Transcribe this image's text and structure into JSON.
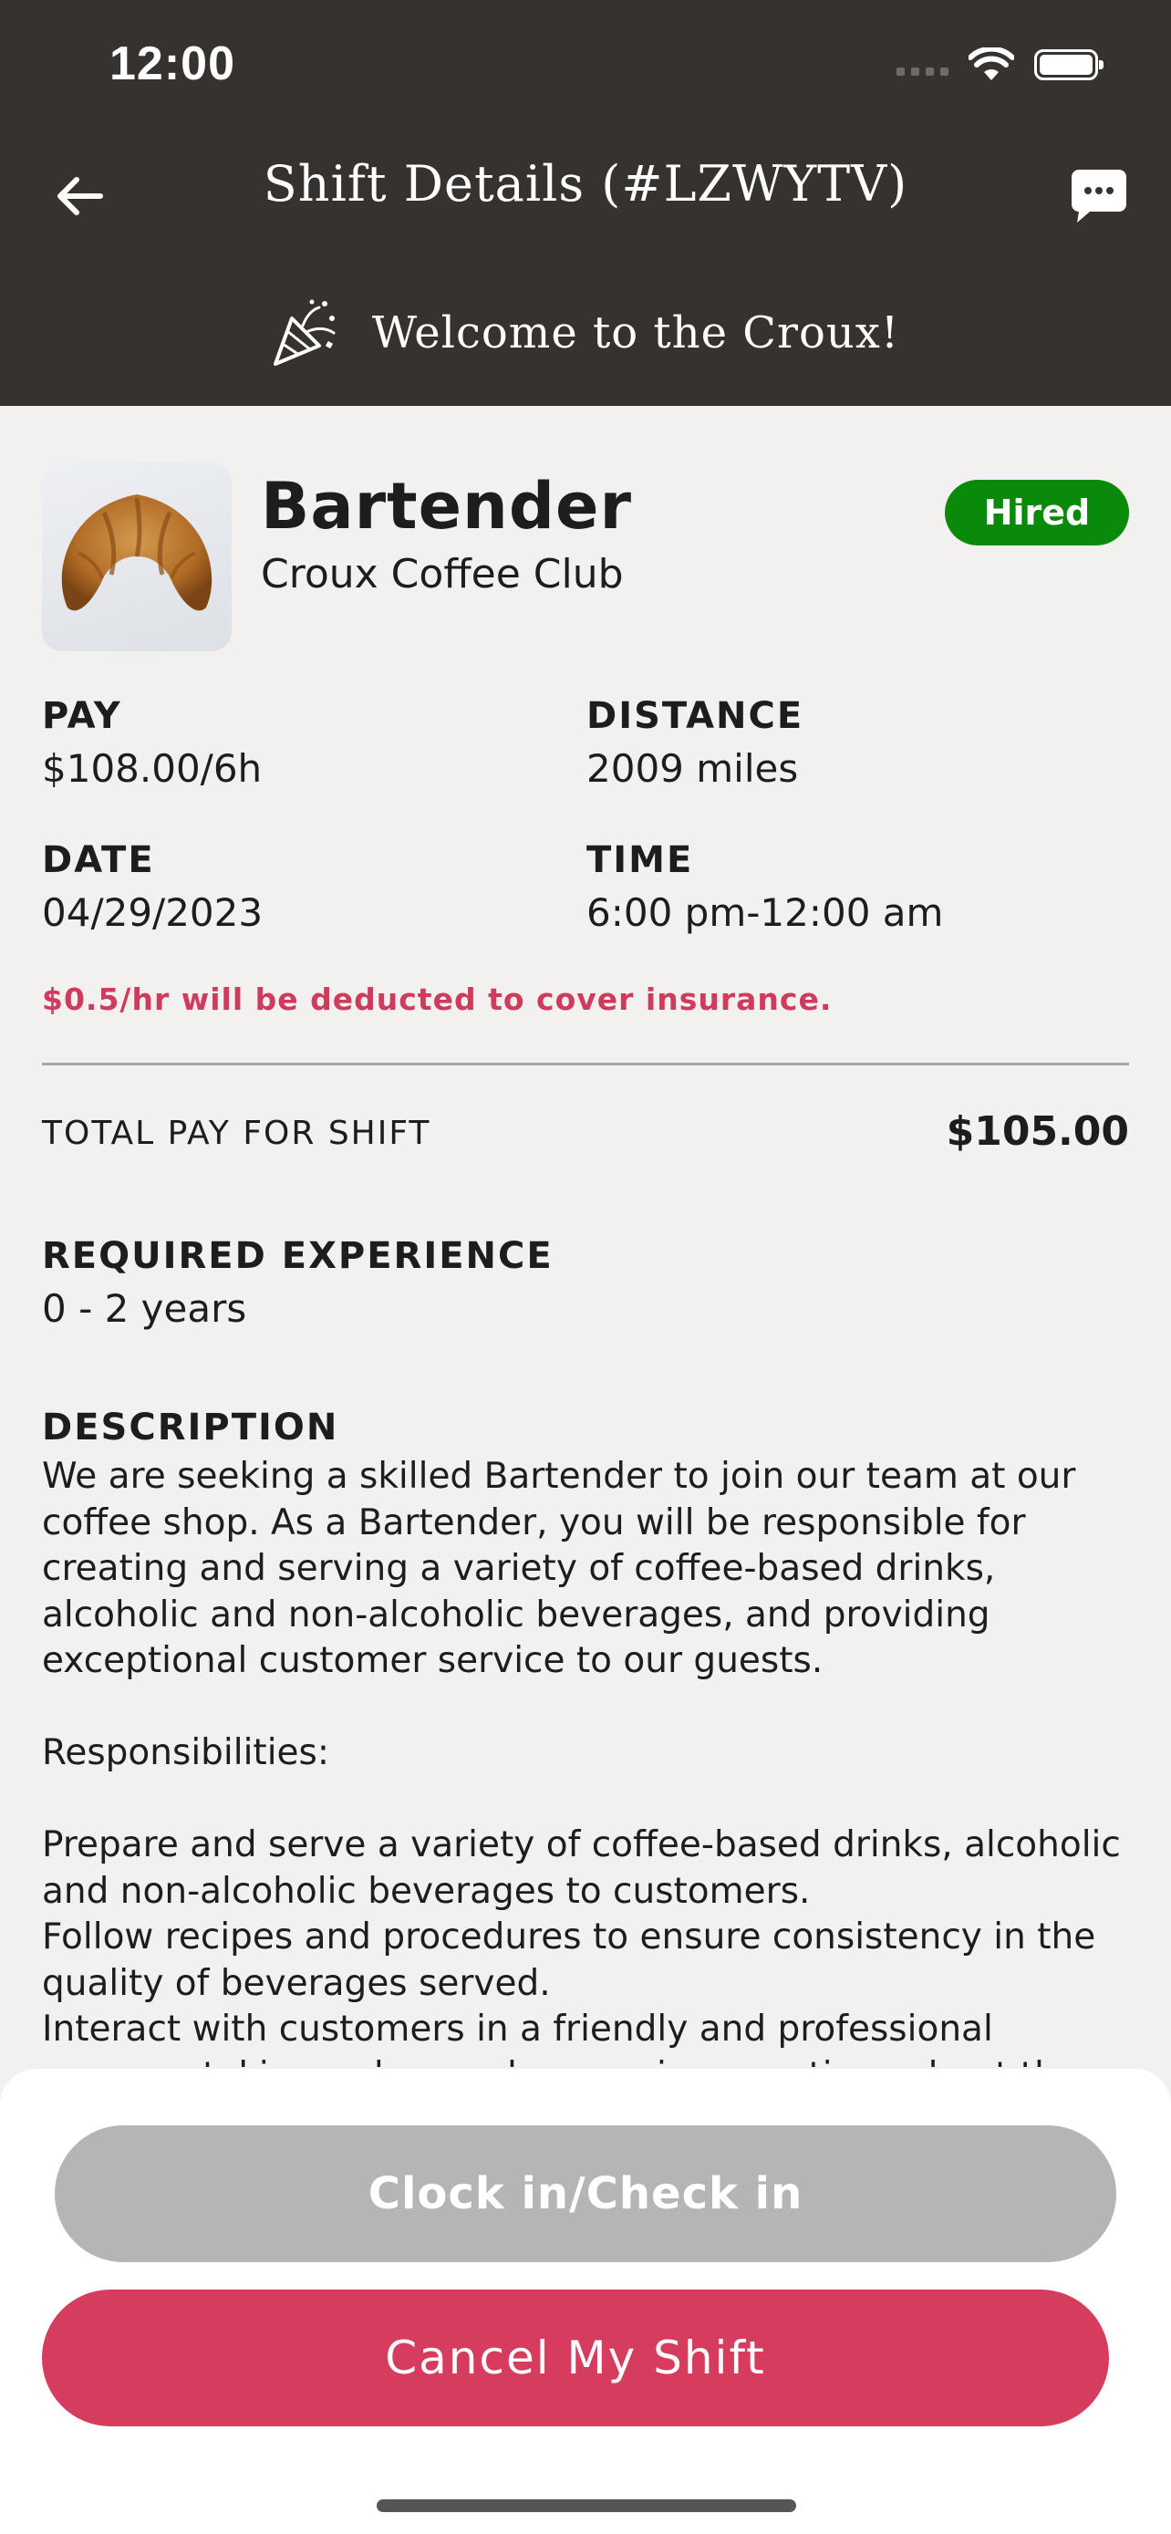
{
  "status_bar": {
    "time": "12:00"
  },
  "header": {
    "title": "Shift Details (#LZWYTV)",
    "welcome": "Welcome to the Croux!",
    "back_icon": "arrow-left-icon",
    "chat_icon": "chat-bubble-icon",
    "welcome_icon": "party-popper-icon"
  },
  "job": {
    "title": "Bartender",
    "company": "Croux Coffee Club",
    "status": "Hired",
    "image": "croissant-image"
  },
  "details": {
    "pay": {
      "label": "PAY",
      "value": "$108.00/6h"
    },
    "distance": {
      "label": "DISTANCE",
      "value": "2009 miles"
    },
    "date": {
      "label": "DATE",
      "value": "04/29/2023"
    },
    "time": {
      "label": "TIME",
      "value": "6:00 pm-12:00 am"
    }
  },
  "insurance_note": "$0.5/hr will be deducted to cover insurance.",
  "total": {
    "label": "TOTAL PAY FOR SHIFT",
    "value": "$105.00"
  },
  "experience": {
    "label": "REQUIRED EXPERIENCE",
    "value": "0 - 2 years"
  },
  "description": {
    "label": "DESCRIPTION",
    "text": "We are seeking a skilled Bartender to join our team at our coffee shop. As a Bartender, you will be responsible for creating and serving a variety of coffee-based drinks, alcoholic and non-alcoholic beverages, and providing exceptional customer service to our guests.\n\nResponsibilities:\n\nPrepare and serve a variety of coffee-based drinks, alcoholic and non-alcoholic beverages to customers.\nFollow recipes and procedures to ensure consistency in the quality of beverages served.\nInteract with customers in a friendly and professional manner, taking orders and answering questions about the"
  },
  "actions": {
    "clock_in": "Clock in/Check in",
    "cancel": "Cancel My Shift"
  },
  "colors": {
    "header_bg": "#363230",
    "page_bg": "#f2f1ef",
    "hired_green": "#0a8a0a",
    "accent_red": "#d53c5d",
    "disabled_gray": "#b5b5b4"
  }
}
